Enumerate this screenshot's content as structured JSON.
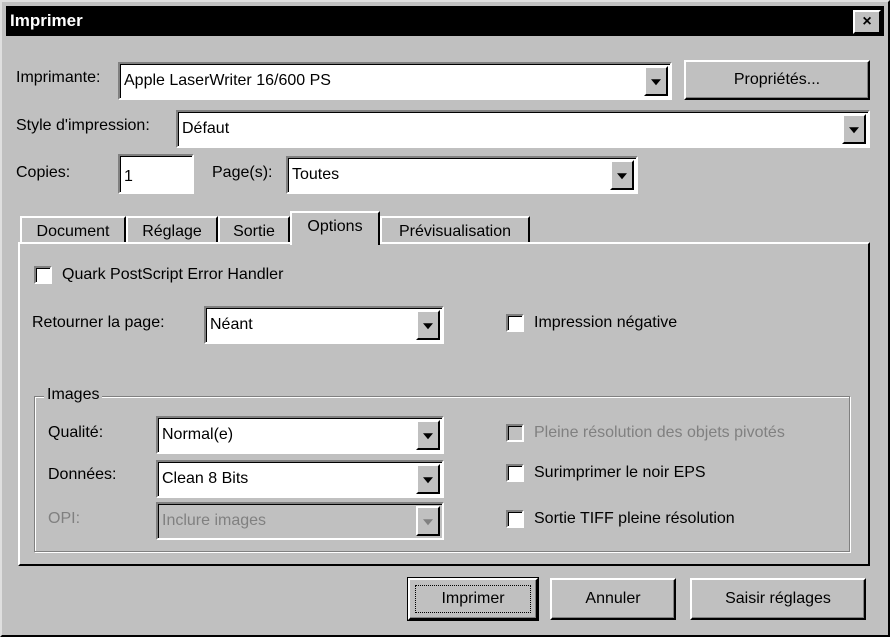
{
  "window": {
    "title": "Imprimer",
    "close_glyph": "×"
  },
  "printer": {
    "label": "Imprimante:",
    "value": "Apple LaserWriter 16/600 PS",
    "properties_button": "Propriétés..."
  },
  "print_style": {
    "label": "Style d'impression:",
    "value": "Défaut"
  },
  "copies": {
    "label": "Copies:",
    "value": "1"
  },
  "pages": {
    "label": "Page(s):",
    "value": "Toutes"
  },
  "tabs": [
    {
      "label": "Document"
    },
    {
      "label": "Réglage"
    },
    {
      "label": "Sortie"
    },
    {
      "label": "Options"
    },
    {
      "label": "Prévisualisation"
    }
  ],
  "active_tab": "Options",
  "options": {
    "error_handler_label": "Quark PostScript Error Handler",
    "error_handler_checked": false,
    "flip_page_label": "Retourner la page:",
    "flip_page_value": "Néant",
    "negative_label": "Impression négative",
    "negative_checked": false
  },
  "images_group": {
    "legend": "Images",
    "quality_label": "Qualité:",
    "quality_value": "Normal(e)",
    "data_label": "Données:",
    "data_value": "Clean 8 Bits",
    "opi_label": "OPI:",
    "opi_value": "Inclure images",
    "full_res_rotated_label": "Pleine résolution des objets pivotés",
    "overprint_eps_label": "Surimprimer le noir EPS",
    "tiff_full_res_label": "Sortie TIFF pleine résolution"
  },
  "buttons": {
    "print": "Imprimer",
    "cancel": "Annuler",
    "capture": "Saisir réglages"
  }
}
